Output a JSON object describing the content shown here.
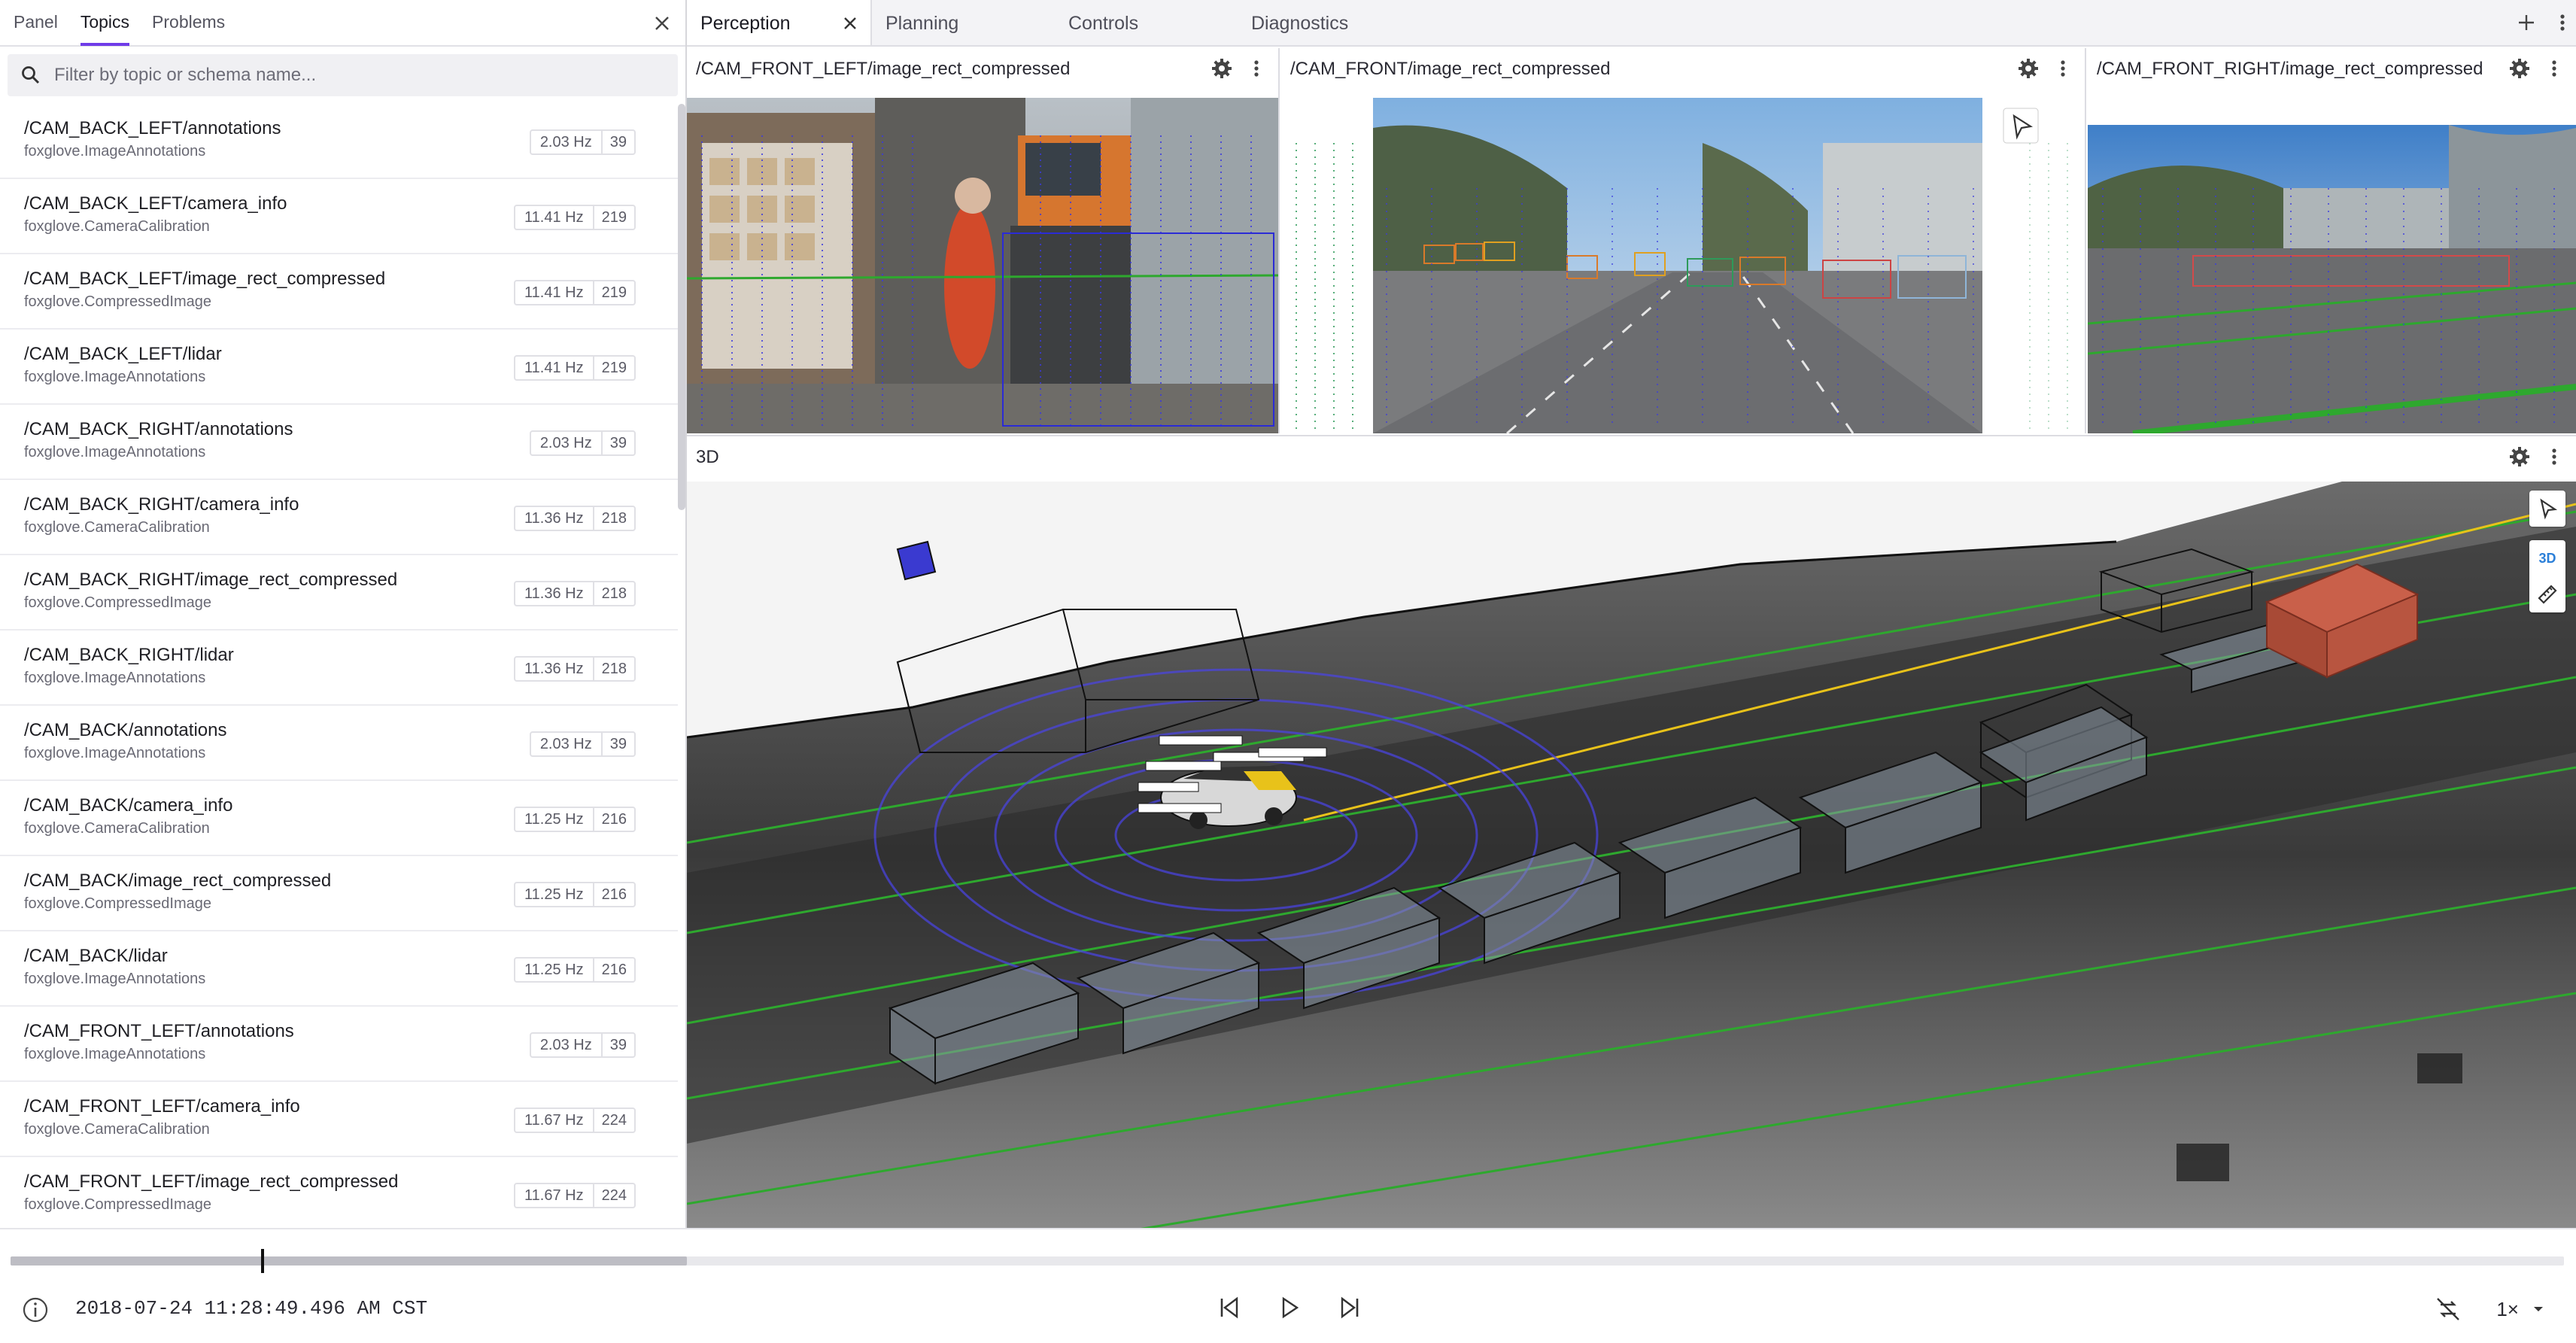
{
  "sidebar": {
    "tabs": [
      "Panel",
      "Topics",
      "Problems"
    ],
    "active_tab": "Topics",
    "search_placeholder": "Filter by topic or schema name...",
    "topics": [
      {
        "name": "/CAM_BACK_LEFT/annotations",
        "schema": "foxglove.ImageAnnotations",
        "hz": "2.03 Hz",
        "count": "39"
      },
      {
        "name": "/CAM_BACK_LEFT/camera_info",
        "schema": "foxglove.CameraCalibration",
        "hz": "11.41 Hz",
        "count": "219"
      },
      {
        "name": "/CAM_BACK_LEFT/image_rect_compressed",
        "schema": "foxglove.CompressedImage",
        "hz": "11.41 Hz",
        "count": "219"
      },
      {
        "name": "/CAM_BACK_LEFT/lidar",
        "schema": "foxglove.ImageAnnotations",
        "hz": "11.41 Hz",
        "count": "219"
      },
      {
        "name": "/CAM_BACK_RIGHT/annotations",
        "schema": "foxglove.ImageAnnotations",
        "hz": "2.03 Hz",
        "count": "39"
      },
      {
        "name": "/CAM_BACK_RIGHT/camera_info",
        "schema": "foxglove.CameraCalibration",
        "hz": "11.36 Hz",
        "count": "218"
      },
      {
        "name": "/CAM_BACK_RIGHT/image_rect_compressed",
        "schema": "foxglove.CompressedImage",
        "hz": "11.36 Hz",
        "count": "218"
      },
      {
        "name": "/CAM_BACK_RIGHT/lidar",
        "schema": "foxglove.ImageAnnotations",
        "hz": "11.36 Hz",
        "count": "218"
      },
      {
        "name": "/CAM_BACK/annotations",
        "schema": "foxglove.ImageAnnotations",
        "hz": "2.03 Hz",
        "count": "39"
      },
      {
        "name": "/CAM_BACK/camera_info",
        "schema": "foxglove.CameraCalibration",
        "hz": "11.25 Hz",
        "count": "216"
      },
      {
        "name": "/CAM_BACK/image_rect_compressed",
        "schema": "foxglove.CompressedImage",
        "hz": "11.25 Hz",
        "count": "216"
      },
      {
        "name": "/CAM_BACK/lidar",
        "schema": "foxglove.ImageAnnotations",
        "hz": "11.25 Hz",
        "count": "216"
      },
      {
        "name": "/CAM_FRONT_LEFT/annotations",
        "schema": "foxglove.ImageAnnotations",
        "hz": "2.03 Hz",
        "count": "39"
      },
      {
        "name": "/CAM_FRONT_LEFT/camera_info",
        "schema": "foxglove.CameraCalibration",
        "hz": "11.67 Hz",
        "count": "224"
      },
      {
        "name": "/CAM_FRONT_LEFT/image_rect_compressed",
        "schema": "foxglove.CompressedImage",
        "hz": "11.67 Hz",
        "count": "224"
      }
    ]
  },
  "layout_tabs": [
    "Perception",
    "Planning",
    "Controls",
    "Diagnostics"
  ],
  "active_layout_tab": "Perception",
  "panels": {
    "cam_front_left": {
      "title": "/CAM_FRONT_LEFT/image_rect_compressed"
    },
    "cam_front": {
      "title": "/CAM_FRONT/image_rect_compressed"
    },
    "cam_front_right": {
      "title": "/CAM_FRONT_RIGHT/image_rect_compressed"
    },
    "threed": {
      "title": "3D",
      "mode_label": "3D"
    }
  },
  "playback": {
    "timestamp": "2018-07-24 11:28:49.496 AM CST",
    "speed": "1×",
    "progress_fraction": 0.098,
    "buffered_fraction": 0.265
  },
  "colors": {
    "accent": "#6f3be8",
    "lane_green": "#2ea82e",
    "path_yellow": "#e8c21a",
    "lidar_blue": "#3a3ae0",
    "box_red": "#b84a32"
  }
}
